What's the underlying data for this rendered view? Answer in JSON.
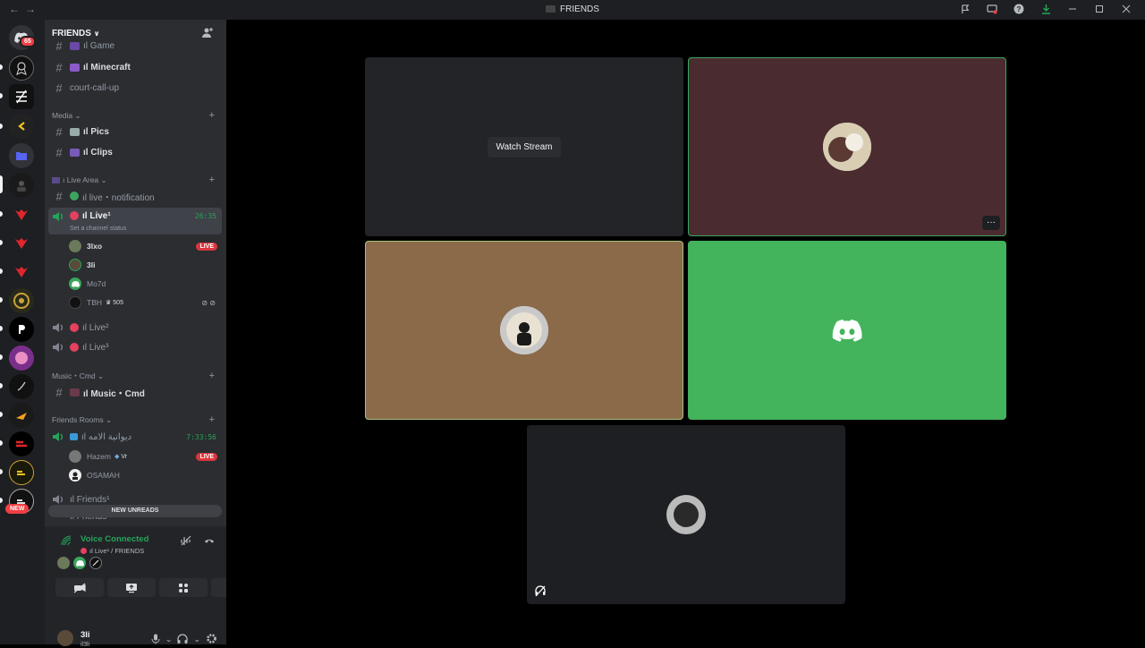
{
  "window": {
    "title": "FRIENDS",
    "nav": {
      "back": "←",
      "forward": "→"
    }
  },
  "guilds": {
    "badge_count": "65",
    "new_label": "NEW"
  },
  "server": {
    "name": "FRIENDS"
  },
  "channels": {
    "game": {
      "label": "ıl Game"
    },
    "minecraft": {
      "label": "ıl Minecraft"
    },
    "court": {
      "label": "court-call-up"
    },
    "media_cat": {
      "label": "Media"
    },
    "pics": {
      "label": "ıl Pics"
    },
    "clips": {
      "label": "ıl Clips"
    },
    "live_cat": {
      "label": "ı Live Area"
    },
    "live_notif": {
      "label": "ıl live・notification"
    },
    "live1": {
      "label": "ıl Live¹",
      "time": "26:35",
      "status": "Set a channel status"
    },
    "live2": {
      "label": "ıl Live²"
    },
    "live3": {
      "label": "ıl Live³"
    },
    "music_cat": {
      "label": "Music・Cmd"
    },
    "music": {
      "label": "ıl Music・Cmd"
    },
    "friends_cat": {
      "label": "Friends Rooms"
    },
    "arabic_room": {
      "label": "ıl ديوانية الامه",
      "time": "7:33:56"
    },
    "friends1": {
      "label": "ıl Friends¹"
    },
    "friends2": {
      "label": "ıl Friends²"
    }
  },
  "members": {
    "m1": {
      "name": "3lxo",
      "badge": "LIVE"
    },
    "m2": {
      "name": "3li"
    },
    "m3": {
      "name": "Mo7d"
    },
    "m4": {
      "name": "TBH",
      "extra": "505"
    },
    "m5": {
      "name": "Hazem",
      "extra": "Vr",
      "badge": "LIVE"
    },
    "m6": {
      "name": "OSAMAH"
    }
  },
  "new_unreads": "NEW UNREADS",
  "voice": {
    "status": "Voice Connected",
    "channel": "ıl Live¹ / FRIENDS"
  },
  "user": {
    "name": "3li",
    "status": "il3li"
  },
  "stage": {
    "watch_label": "Watch Stream",
    "more": "···"
  },
  "colors": {
    "accent_green": "#23a55a",
    "live_red": "#da373c",
    "discord_green_tile": "#43b35c",
    "tan_tile": "#8b6a4a",
    "maroon_tile": "#4a2c30"
  }
}
